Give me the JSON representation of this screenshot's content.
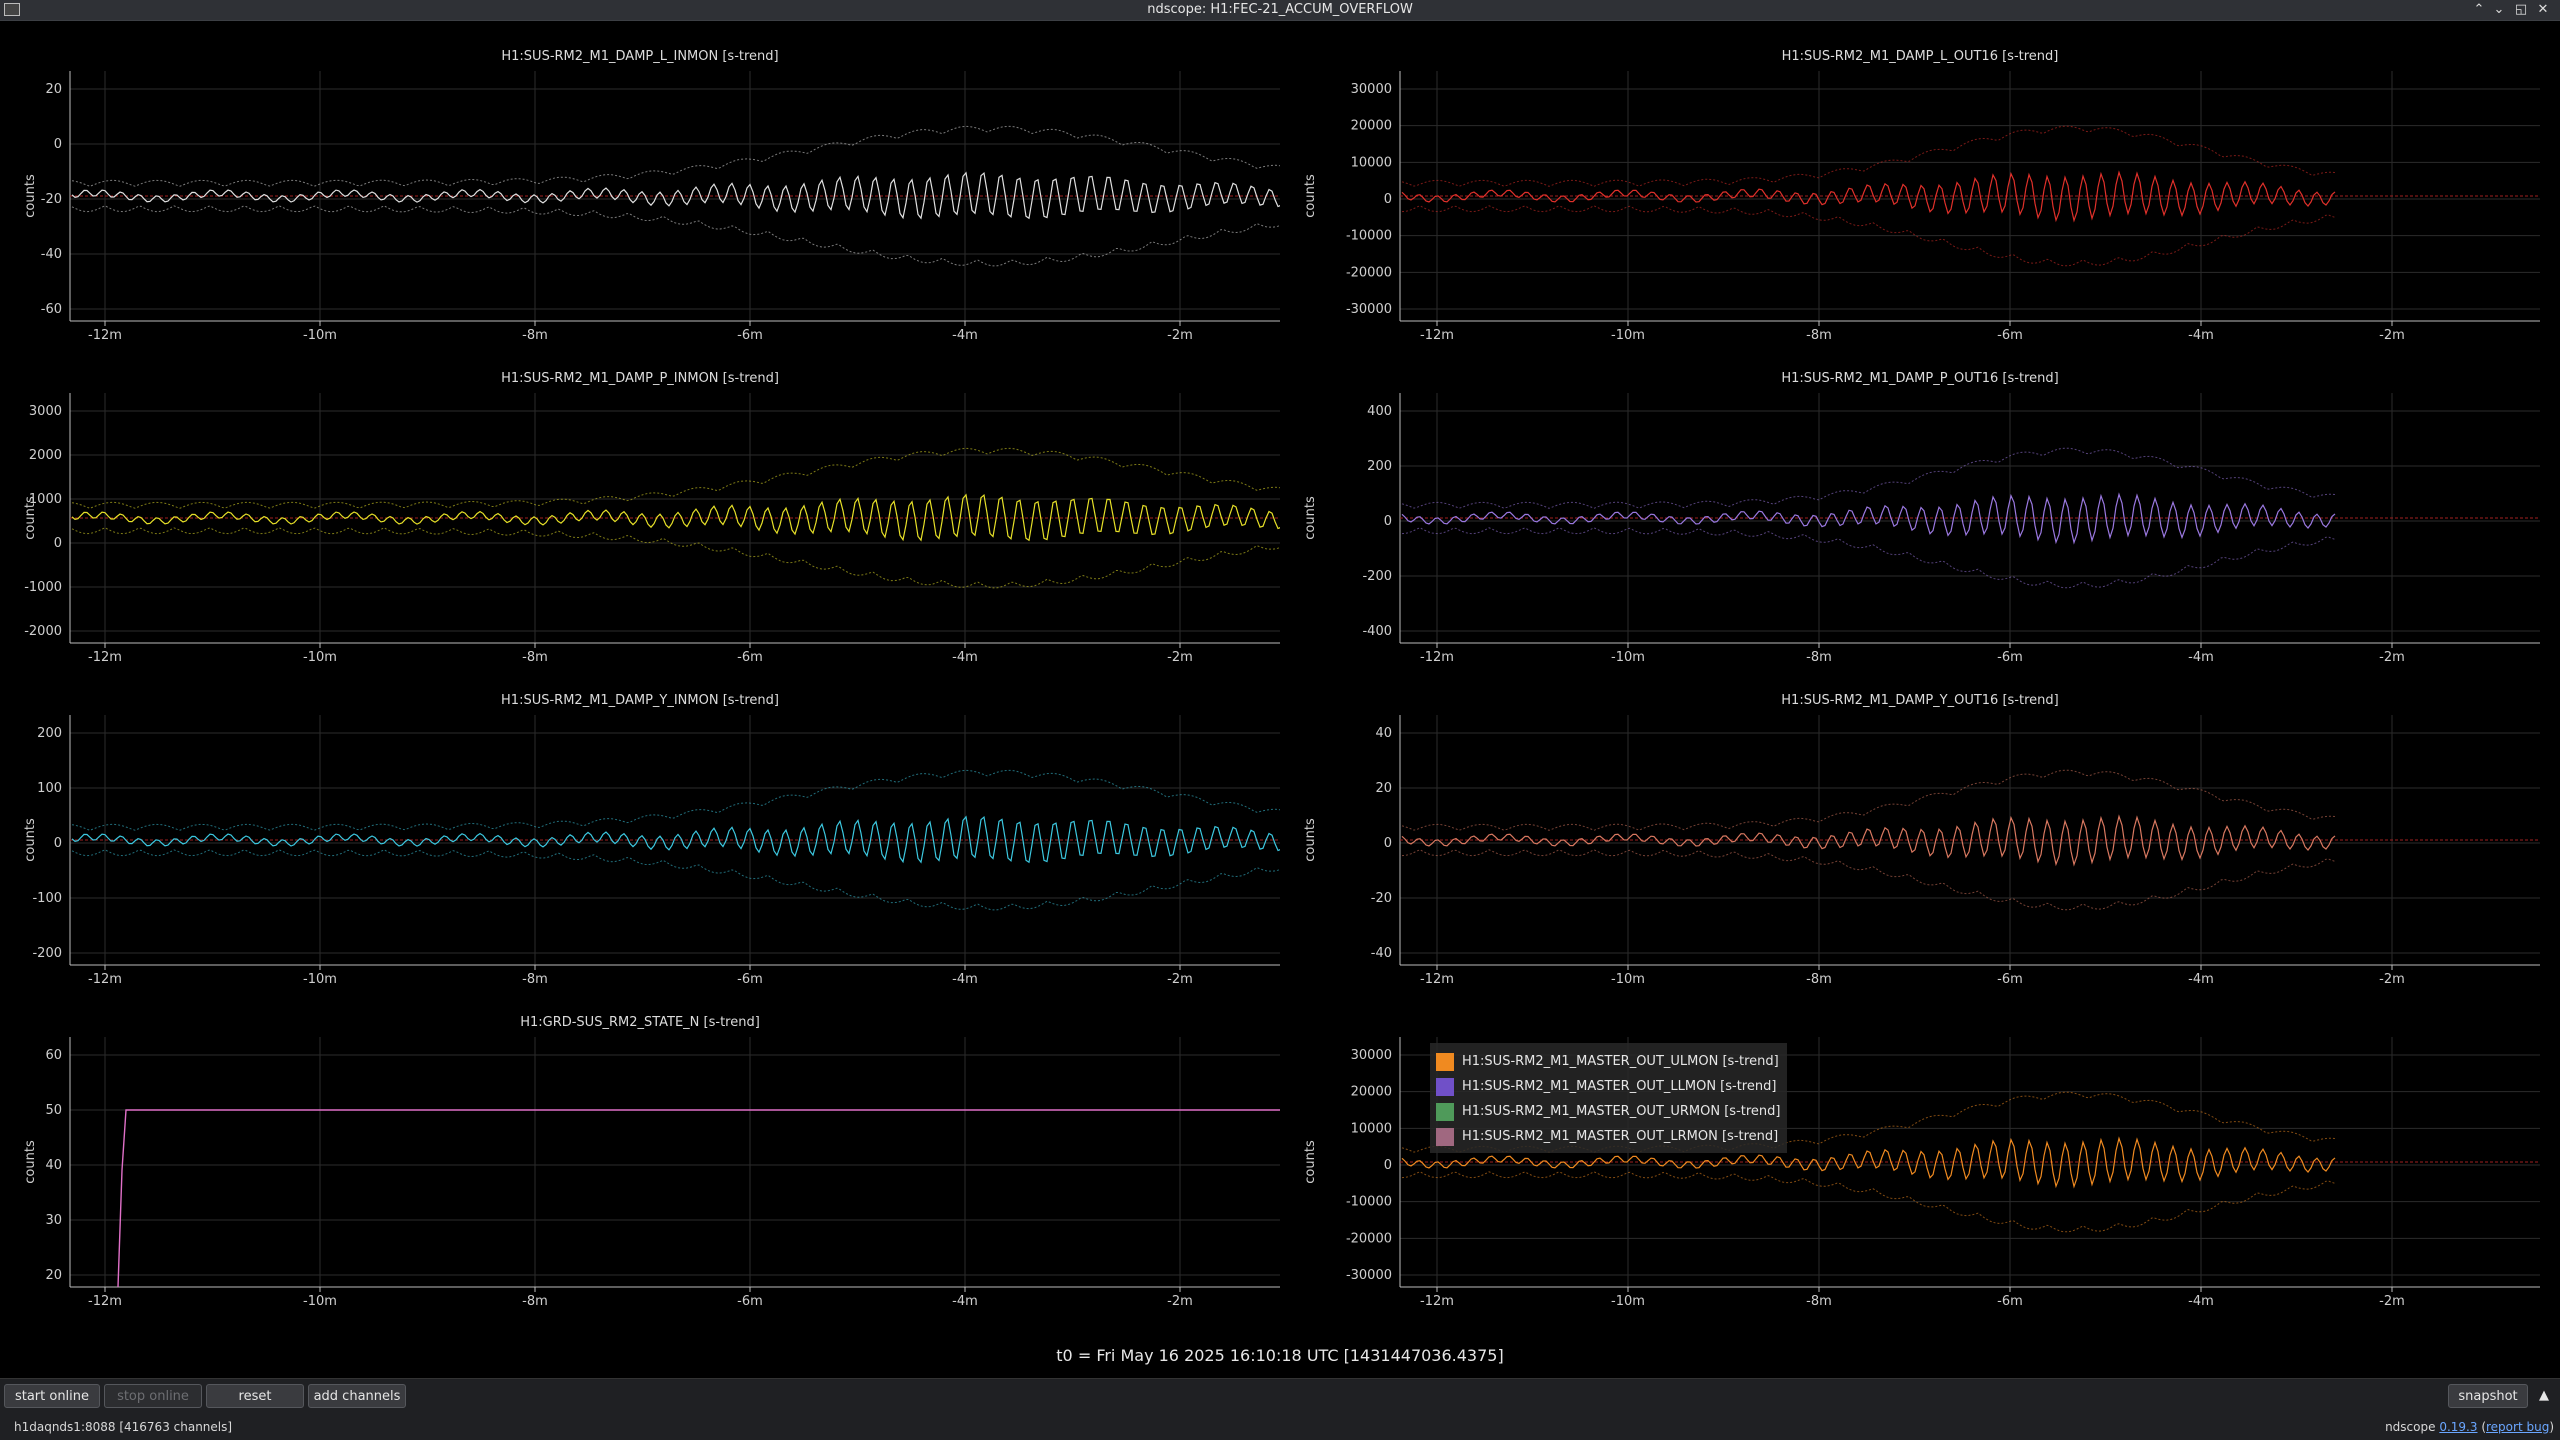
{
  "window": {
    "title": "ndscope: H1:FEC-21_ACCUM_OVERFLOW"
  },
  "plots": [
    {
      "id": "p1",
      "title": "H1:SUS-RM2_M1_DAMP_L_INMON [s-trend]",
      "ylabel": "counts",
      "yticks": [
        "20",
        "0",
        "-20",
        "-40",
        "-60"
      ],
      "xticks": [
        "-12m",
        "-10m",
        "-8m",
        "-6m",
        "-4m",
        "-2m"
      ],
      "color": "#e0e0e0"
    },
    {
      "id": "p2",
      "title": "H1:SUS-RM2_M1_DAMP_L_OUT16 [s-trend]",
      "ylabel": "counts",
      "yticks": [
        "30000",
        "20000",
        "10000",
        "0",
        "-10000",
        "-20000",
        "-30000"
      ],
      "xticks": [
        "-12m",
        "-10m",
        "-8m",
        "-6m",
        "-4m",
        "-2m"
      ],
      "color": "#e0302a"
    },
    {
      "id": "p3",
      "title": "H1:SUS-RM2_M1_DAMP_P_INMON [s-trend]",
      "ylabel": "counts",
      "yticks": [
        "3000",
        "2000",
        "1000",
        "0",
        "-1000",
        "-2000"
      ],
      "xticks": [
        "-12m",
        "-10m",
        "-8m",
        "-6m",
        "-4m",
        "-2m"
      ],
      "color": "#e6e028"
    },
    {
      "id": "p4",
      "title": "H1:SUS-RM2_M1_DAMP_P_OUT16 [s-trend]",
      "ylabel": "counts",
      "yticks": [
        "400",
        "200",
        "0",
        "-200",
        "-400"
      ],
      "xticks": [
        "-12m",
        "-10m",
        "-8m",
        "-6m",
        "-4m",
        "-2m"
      ],
      "color": "#9a78e0"
    },
    {
      "id": "p5",
      "title": "H1:SUS-RM2_M1_DAMP_Y_INMON [s-trend]",
      "ylabel": "counts",
      "yticks": [
        "200",
        "100",
        "0",
        "-100",
        "-200"
      ],
      "xticks": [
        "-12m",
        "-10m",
        "-8m",
        "-6m",
        "-4m",
        "-2m"
      ],
      "color": "#3cc8e0"
    },
    {
      "id": "p6",
      "title": "H1:SUS-RM2_M1_DAMP_Y_OUT16 [s-trend]",
      "ylabel": "counts",
      "yticks": [
        "40",
        "20",
        "0",
        "-20",
        "-40"
      ],
      "xticks": [
        "-12m",
        "-10m",
        "-8m",
        "-6m",
        "-4m",
        "-2m"
      ],
      "color": "#d87860"
    },
    {
      "id": "p7",
      "title": "H1:GRD-SUS_RM2_STATE_N [s-trend]",
      "ylabel": "counts",
      "yticks": [
        "60",
        "50",
        "40",
        "30",
        "20"
      ],
      "xticks": [
        "-12m",
        "-10m",
        "-8m",
        "-6m",
        "-4m",
        "-2m"
      ],
      "color": "#e070c8"
    },
    {
      "id": "p8",
      "title": "",
      "ylabel": "counts",
      "yticks": [
        "30000",
        "20000",
        "10000",
        "0",
        "-10000",
        "-20000",
        "-30000"
      ],
      "xticks": [
        "-12m",
        "-10m",
        "-8m",
        "-6m",
        "-4m",
        "-2m"
      ],
      "color": "#f08a20",
      "legend": [
        {
          "label": "H1:SUS-RM2_M1_MASTER_OUT_ULMON [s-trend]",
          "color": "#f08a20"
        },
        {
          "label": "H1:SUS-RM2_M1_MASTER_OUT_LLMON [s-trend]",
          "color": "#7050c8"
        },
        {
          "label": "H1:SUS-RM2_M1_MASTER_OUT_URMON [s-trend]",
          "color": "#4f9a5a"
        },
        {
          "label": "H1:SUS-RM2_M1_MASTER_OUT_LRMON [s-trend]",
          "color": "#a06880"
        }
      ]
    }
  ],
  "t0_text": "t0 = Fri May 16 2025 16:10:18 UTC [1431447036.4375]",
  "toolbar": {
    "start_online": "start online",
    "stop_online": "stop online",
    "reset": "reset",
    "add_channels": "add channels",
    "snapshot": "snapshot",
    "collapse": "▲"
  },
  "status": {
    "server": "h1daqnds1:8088  [416763 channels]",
    "app_name": "ndscope",
    "version": "0.19.3",
    "report_bug": "report bug"
  }
}
